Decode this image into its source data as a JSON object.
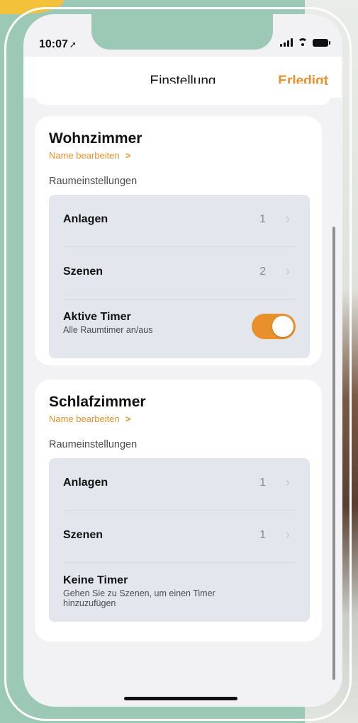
{
  "status_bar": {
    "time": "10:07"
  },
  "navbar": {
    "title": "Einstellung",
    "done_label": "Erledigt"
  },
  "rooms": [
    {
      "name": "Wohnzimmer",
      "edit_label": "Name bearbeiten",
      "section_label": "Raumeinstellungen",
      "rows": [
        {
          "label": "Anlagen",
          "count": "1"
        },
        {
          "label": "Szenen",
          "count": "2"
        }
      ],
      "timer": {
        "title": "Aktive Timer",
        "subtitle": "Alle Raumtimer an/aus",
        "enabled": true
      }
    },
    {
      "name": "Schlafzimmer",
      "edit_label": "Name bearbeiten",
      "section_label": "Raumeinstellungen",
      "rows": [
        {
          "label": "Anlagen",
          "count": "1"
        },
        {
          "label": "Szenen",
          "count": "1"
        }
      ],
      "timer": {
        "title": "Keine Timer",
        "subtitle": "Gehen Sie zu Szenen, um einen Timer hinzuzufügen"
      }
    }
  ],
  "colors": {
    "accent": "#e8912c",
    "background": "#f2f2f5",
    "group_bg": "#e4e6ed",
    "outer_bg": "#9cc9b5"
  }
}
